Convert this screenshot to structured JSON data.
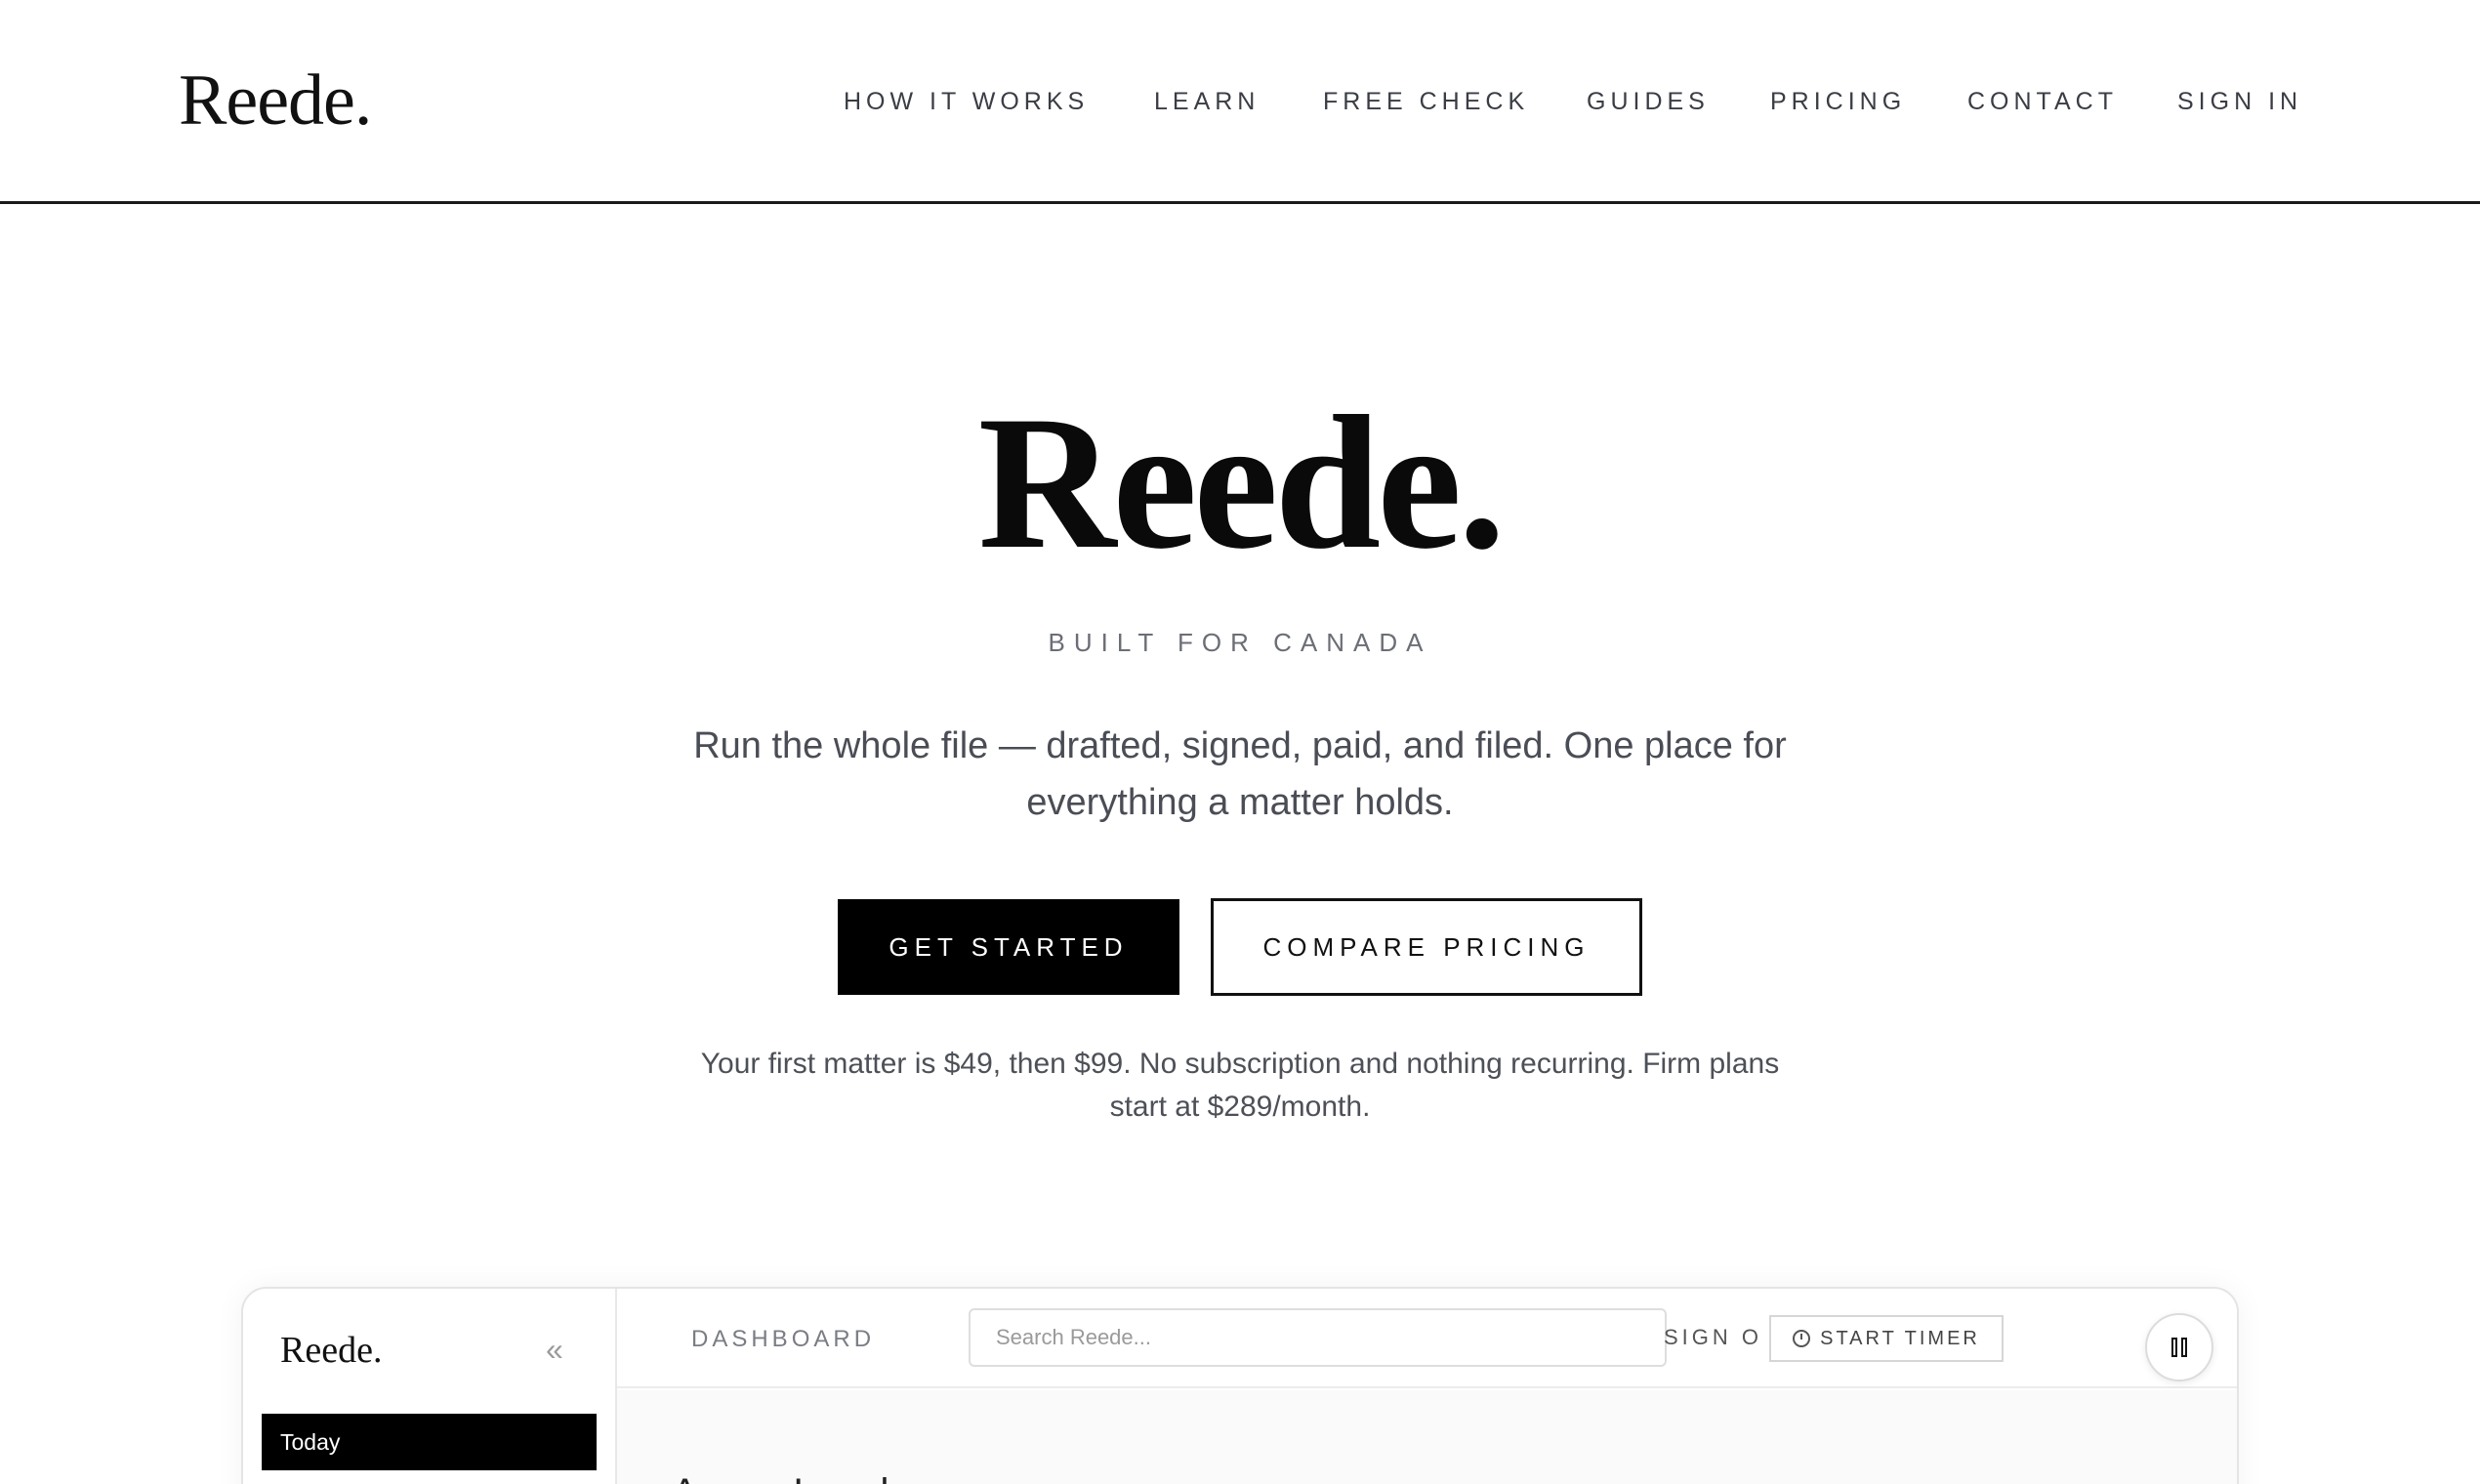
{
  "header": {
    "brand": "Reede.",
    "nav": [
      {
        "label": "HOW IT WORKS"
      },
      {
        "label": "LEARN"
      },
      {
        "label": "FREE CHECK"
      },
      {
        "label": "GUIDES"
      },
      {
        "label": "PRICING"
      },
      {
        "label": "CONTACT"
      },
      {
        "label": "SIGN IN"
      }
    ]
  },
  "hero": {
    "title": "Reede.",
    "kicker": "BUILT FOR CANADA",
    "lead": "Run the whole file — drafted, signed, paid, and filed. One place for everything a matter holds.",
    "primary_cta": "GET STARTED",
    "secondary_cta": "COMPARE PRICING",
    "note": "Your first matter is $49, then $99. No subscription and nothing recurring. Firm plans start at $289/month."
  },
  "preview": {
    "brand": "Reede.",
    "collapse_glyph": "«",
    "sidebar_active": "Today",
    "nav_label": "DASHBOARD",
    "search_placeholder": "Search Reede...",
    "timer_label": "START TIMER",
    "signout_label": "SIGN OUT",
    "heading": "Aspen Legal"
  },
  "colors": {
    "accent": "#000000",
    "text_muted": "#4a4d55",
    "border": "#1a1a1a"
  },
  "icons": [
    "clock-icon",
    "pause-icon",
    "collapse-chevrons-icon"
  ]
}
